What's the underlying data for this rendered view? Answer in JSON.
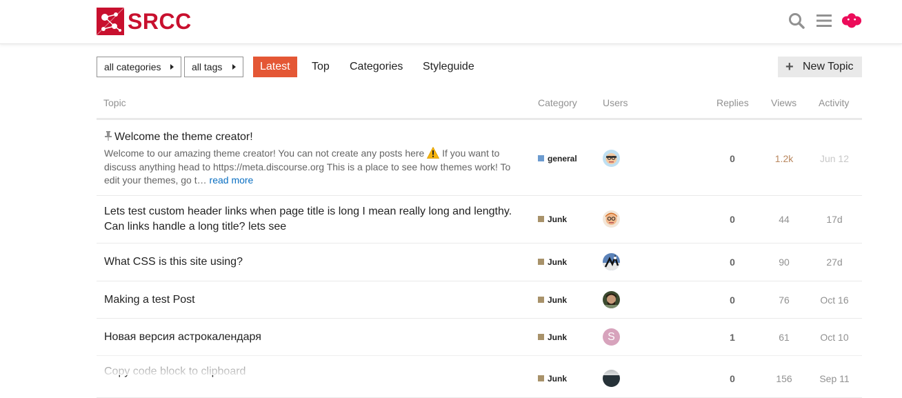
{
  "site": {
    "logo_text": "SRCC",
    "brand_color": "#c8102e"
  },
  "header": {
    "icons": [
      "search-icon",
      "hamburger-menu-icon",
      "user-avatar"
    ]
  },
  "nav": {
    "categories_dropdown": "all categories",
    "tags_dropdown": "all tags",
    "tabs": [
      {
        "label": "Latest",
        "active": true
      },
      {
        "label": "Top",
        "active": false
      },
      {
        "label": "Categories",
        "active": false
      },
      {
        "label": "Styleguide",
        "active": false
      }
    ],
    "new_topic": "New Topic",
    "active_color": "#e45735"
  },
  "columns": {
    "topic": "Topic",
    "category": "Category",
    "users": "Users",
    "replies": "Replies",
    "views": "Views",
    "activity": "Activity"
  },
  "topics": [
    {
      "title": "Welcome the theme creator!",
      "pinned": true,
      "excerpt_1": "Welcome to our amazing theme creator! You can not create any posts here",
      "excerpt_2": "If you want to discuss anything head to https://meta.discourse.org This is a place to see how themes work! To edit your themes, go t…",
      "read_more": "read more",
      "category": "general",
      "category_color": "#6c9bcf",
      "replies": "0",
      "views": "1.2k",
      "activity": "Jun 12"
    },
    {
      "title": "Lets test custom header links when page title is long I mean really long and lengthy. Can links handle a long title? lets see",
      "category": "Junk",
      "category_color": "#a8926a",
      "replies": "0",
      "views": "44",
      "activity": "17d"
    },
    {
      "title": "What CSS is this site using?",
      "category": "Junk",
      "category_color": "#a8926a",
      "replies": "0",
      "views": "90",
      "activity": "27d"
    },
    {
      "title": "Making a test Post",
      "category": "Junk",
      "category_color": "#a8926a",
      "replies": "0",
      "views": "76",
      "activity": "Oct 16"
    },
    {
      "title": "Новая версия астрокалендаря",
      "category": "Junk",
      "category_color": "#a8926a",
      "replies": "1",
      "views": "61",
      "activity": "Oct 10",
      "avatar_letter": "S"
    },
    {
      "title": "Copy code block to clipboard",
      "category": "Junk",
      "category_color": "#a8926a",
      "replies": "0",
      "views": "156",
      "activity": "Sep 11"
    }
  ]
}
